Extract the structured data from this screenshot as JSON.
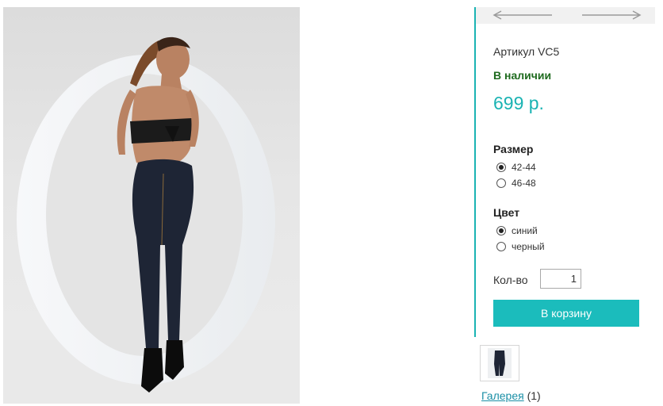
{
  "product": {
    "sku": "Артикул VC5",
    "stock": "В наличии",
    "price": "699 р.",
    "image_alt": "product-photo"
  },
  "nav": {
    "prev_icon": "arrow-left-icon",
    "next_icon": "arrow-right-icon"
  },
  "size": {
    "title": "Размер",
    "options": [
      {
        "label": "42-44",
        "checked": true
      },
      {
        "label": "46-48",
        "checked": false
      }
    ]
  },
  "color": {
    "title": "Цвет",
    "options": [
      {
        "label": "синий",
        "checked": true
      },
      {
        "label": "черный",
        "checked": false
      }
    ]
  },
  "quantity": {
    "label": "Кол-во",
    "value": "1"
  },
  "cart": {
    "button_label": "В корзину"
  },
  "gallery": {
    "link_label": "Галерея",
    "count": "(1)"
  },
  "colors": {
    "accent": "#1ab3b3",
    "button": "#1bbcbc",
    "stock": "#1f6b1f",
    "link": "#1a8fa6"
  }
}
